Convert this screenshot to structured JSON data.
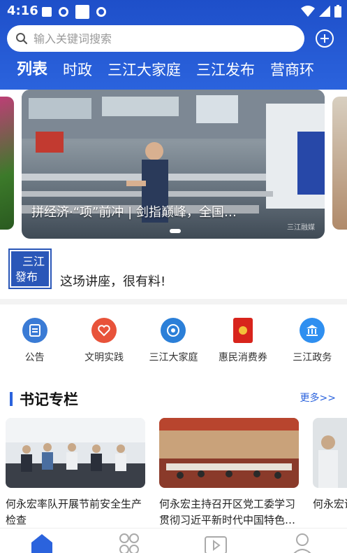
{
  "status": {
    "time": "4:16"
  },
  "search": {
    "placeholder": "输入关键词搜索"
  },
  "tabs": [
    "列表",
    "时政",
    "三江大家庭",
    "三江发布",
    "营商环"
  ],
  "carousel": {
    "caption": "拼经济·“项”前冲 | 剑指巅峰，全国…",
    "watermark": "三江融媒"
  },
  "notice": {
    "logo_line1": "三江",
    "logo_line2": "發布",
    "text": "这场讲座，很有料!"
  },
  "quick": [
    {
      "label": "公告",
      "icon": "notice-icon",
      "color": "#3a7bd5"
    },
    {
      "label": "文明实践",
      "icon": "heart-hands-icon",
      "color": "#e8533a"
    },
    {
      "label": "三江大家庭",
      "icon": "circle-network-icon",
      "color": "#2b7fd8"
    },
    {
      "label": "惠民消费券",
      "icon": "red-envelope-icon",
      "color": "#d8241c"
    },
    {
      "label": "三江政务",
      "icon": "government-building-icon",
      "color": "#2f8ff0"
    }
  ],
  "section": {
    "title": "书记专栏",
    "more": "更多>>"
  },
  "cards": [
    {
      "title": "何永宏率队开展节前安全生产检查"
    },
    {
      "title": "何永宏主持召开区党工委学习贯彻习近平新时代中国特色…"
    },
    {
      "title": "何永宏调研情况"
    }
  ],
  "tabbar": [
    "home-icon",
    "apps-grid-icon",
    "video-icon",
    "profile-icon"
  ],
  "colors": {
    "brand": "#2b63dd",
    "header_top": "#1e4fc9"
  }
}
